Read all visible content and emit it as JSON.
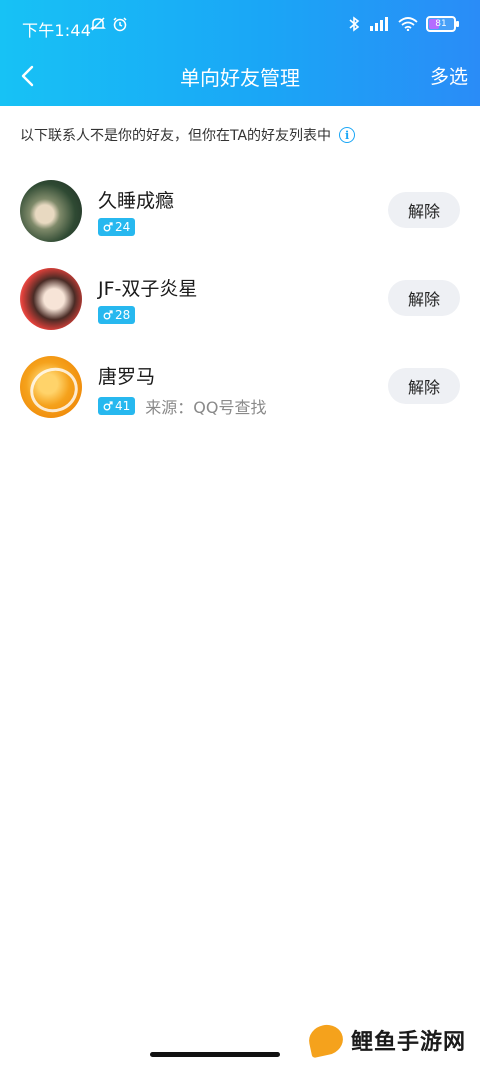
{
  "status_bar": {
    "time": "下午1:44",
    "battery": "81",
    "icons_left": [
      "mute-icon",
      "alarm-icon"
    ],
    "icons_right": [
      "bluetooth-icon",
      "signal-icon",
      "wifi-icon",
      "battery-icon"
    ]
  },
  "nav": {
    "title": "单向好友管理",
    "action": "多选"
  },
  "notice": {
    "text": "以下联系人不是你的好友，但你在TA的好友列表中",
    "icon": "i"
  },
  "contacts": [
    {
      "name": "久睡成瘾",
      "age": "24",
      "source": "",
      "action": "解除"
    },
    {
      "name": "JF-双子炎星",
      "age": "28",
      "source": "",
      "action": "解除"
    },
    {
      "name": "唐罗马",
      "age": "41",
      "source": "来源：QQ号查找",
      "action": "解除"
    }
  ],
  "watermark": {
    "text": "鲤鱼手游网"
  },
  "colors": {
    "header_start": "#17c2f5",
    "header_end": "#2a8cf7",
    "badge": "#27b8ef",
    "button_bg": "#eef0f4"
  }
}
